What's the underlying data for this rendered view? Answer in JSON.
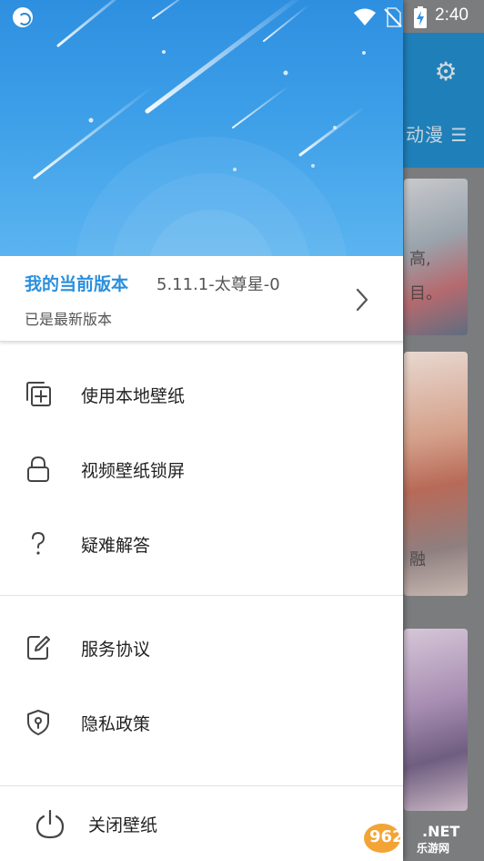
{
  "status_bar": {
    "time": "2:40",
    "icons": [
      "app-sync-icon",
      "wifi-icon",
      "no-sim-icon",
      "battery-charging-icon"
    ]
  },
  "background_app": {
    "tab_label": "动漫",
    "tab_menu_glyph": "☰",
    "settings_icon": "gear-icon",
    "card_texts": [
      "高,",
      "目。",
      "融"
    ]
  },
  "drawer": {
    "version": {
      "title": "我的当前版本",
      "number": "5.11.1-太尊星-0",
      "status": "已是最新版本"
    },
    "menu_group_1": [
      {
        "label": "使用本地壁纸",
        "icon": "add-local-wallpaper-icon"
      },
      {
        "label": "视频壁纸锁屏",
        "icon": "lock-icon"
      },
      {
        "label": "疑难解答",
        "icon": "question-icon"
      }
    ],
    "menu_group_2": [
      {
        "label": "服务协议",
        "icon": "edit-document-icon"
      },
      {
        "label": "隐私政策",
        "icon": "shield-icon"
      }
    ],
    "close_label": "关闭壁纸"
  },
  "watermark": {
    "logo": "962.NET",
    "text": "乐游网"
  },
  "colors": {
    "accent": "#2b8fdc",
    "header_top": "#2e8fe0",
    "header_bottom": "#5bb4f0"
  }
}
